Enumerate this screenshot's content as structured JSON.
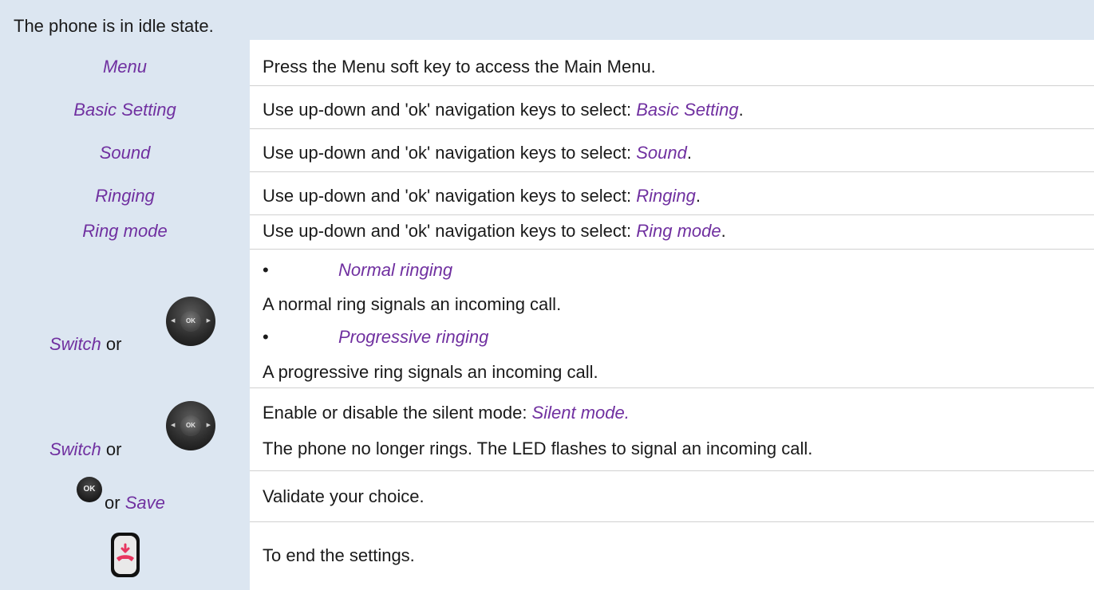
{
  "header": {
    "text": "The phone is in idle state."
  },
  "rows": [
    {
      "left": "Menu",
      "right": "Press the Menu soft key to access the Main Menu."
    },
    {
      "left": "Basic Setting",
      "right_prefix": "Use up-down and 'ok' navigation keys to select: ",
      "right_term": "Basic Setting",
      "right_suffix": "."
    },
    {
      "left": "Sound",
      "right_prefix": "Use up-down and 'ok' navigation keys to select: ",
      "right_term": "Sound",
      "right_suffix": "."
    },
    {
      "left": "Ringing",
      "right_prefix": "Use up-down and 'ok' navigation keys to select: ",
      "right_term": "Ringing",
      "right_suffix": "."
    },
    {
      "left": "Ring mode",
      "right_prefix": "Use up-down and 'ok' navigation keys to select: ",
      "right_term": "Ring mode",
      "right_suffix": "."
    }
  ],
  "switch_row": {
    "left_term": "Switch",
    "left_or": " or",
    "bullet_glyph": "•",
    "option1": "Normal ringing",
    "option1_desc": "A normal ring signals an incoming call.",
    "option2": "Progressive ringing",
    "option2_desc": "A progressive ring signals an incoming call."
  },
  "silent_row": {
    "left_term": "Switch",
    "left_or": " or",
    "line1_prefix": "Enable or disable the silent mode: ",
    "line1_term": "Silent mode.",
    "line2": "The phone no longer rings. The LED flashes to signal an incoming call."
  },
  "validate_row": {
    "left_or": "or ",
    "left_term": "Save",
    "right": "Validate your choice."
  },
  "end_row": {
    "right": "To end the settings."
  },
  "key_labels": {
    "ok": "OK"
  },
  "icons": {
    "navigator": "navigator-key-icon",
    "ok": "ok-key-icon",
    "end_call": "end-call-key-icon"
  },
  "colors": {
    "accent": "#7030a0",
    "shade": "#dce6f1",
    "text": "#1a1a1a",
    "end_call_red": "#e8365f"
  }
}
